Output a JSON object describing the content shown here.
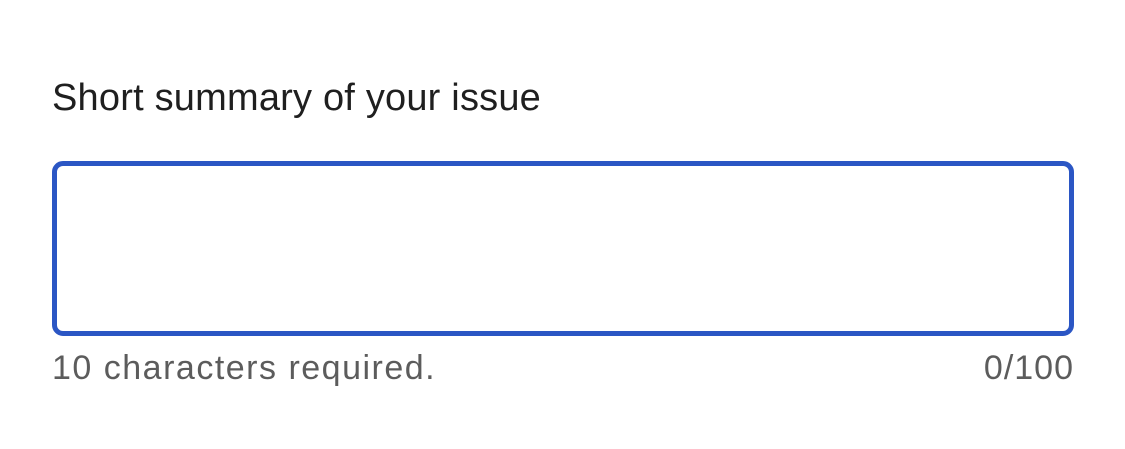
{
  "form": {
    "summary": {
      "label": "Short summary of your issue",
      "value": "",
      "placeholder": "",
      "helper_text": "10 characters required.",
      "char_count": "0/100",
      "accent_color": "#2b56c4"
    }
  }
}
